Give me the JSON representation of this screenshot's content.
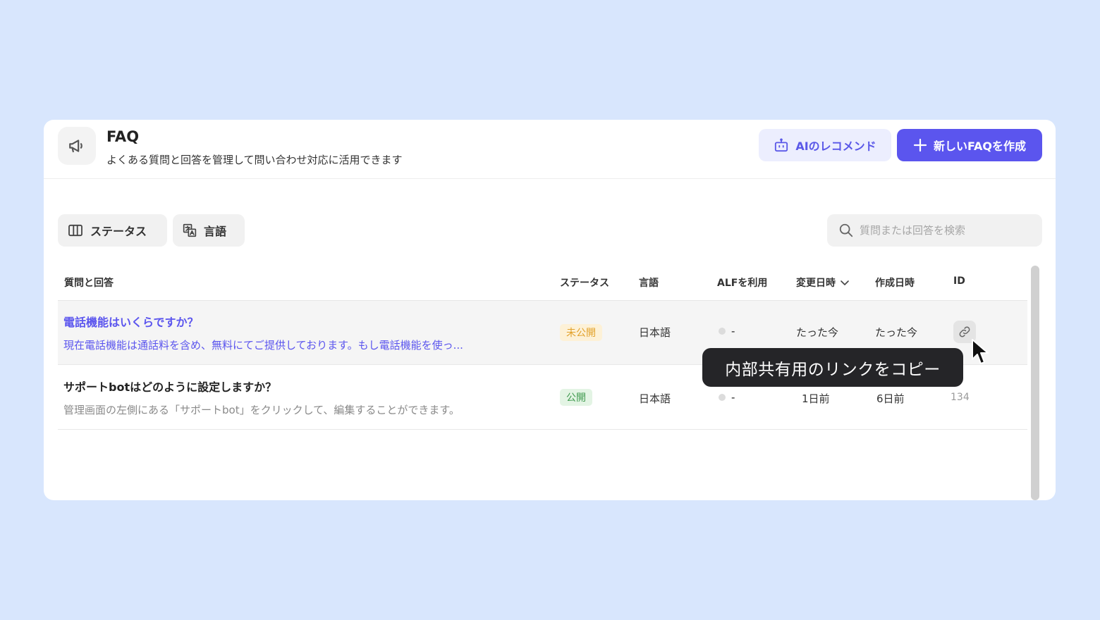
{
  "header": {
    "title": "FAQ",
    "subtitle": "よくある質問と回答を管理して問い合わせ対応に活用できます",
    "icon": "megaphone-icon",
    "ai_button_label": "AIのレコメンド",
    "new_button_label": "新しいFAQを作成"
  },
  "filters": {
    "status_label": "ステータス",
    "language_label": "言語",
    "search_placeholder": "質問または回答を検索"
  },
  "table": {
    "columns": [
      "質問と回答",
      "ステータス",
      "言語",
      "ALFを利用",
      "変更日時",
      "作成日時",
      "ID"
    ],
    "rows": [
      {
        "question": "電話機能はいくらですか？",
        "answer": "現在電話機能は通話料を含め、無料にてご提供しております。もし電話機能を使っ...",
        "status": "未公開",
        "language": "日本語",
        "alf": "-",
        "updated": "たった今",
        "created": "たった今",
        "id": ""
      },
      {
        "question": "サポートbotはどのように設定しますか？",
        "answer": "管理画面の左側にある「サポートbot」をクリックして、編集することができます。",
        "status": "公開",
        "language": "日本語",
        "alf": "-",
        "updated": "1日前",
        "created": "6日前",
        "id": "134"
      }
    ]
  },
  "tooltip": {
    "text": "内部共有用のリンクをコピー"
  },
  "colors": {
    "background": "#d8e6fd",
    "accent": "#5b55ee",
    "draft_badge": "#e2a12a",
    "public_badge": "#3f9a4e"
  }
}
